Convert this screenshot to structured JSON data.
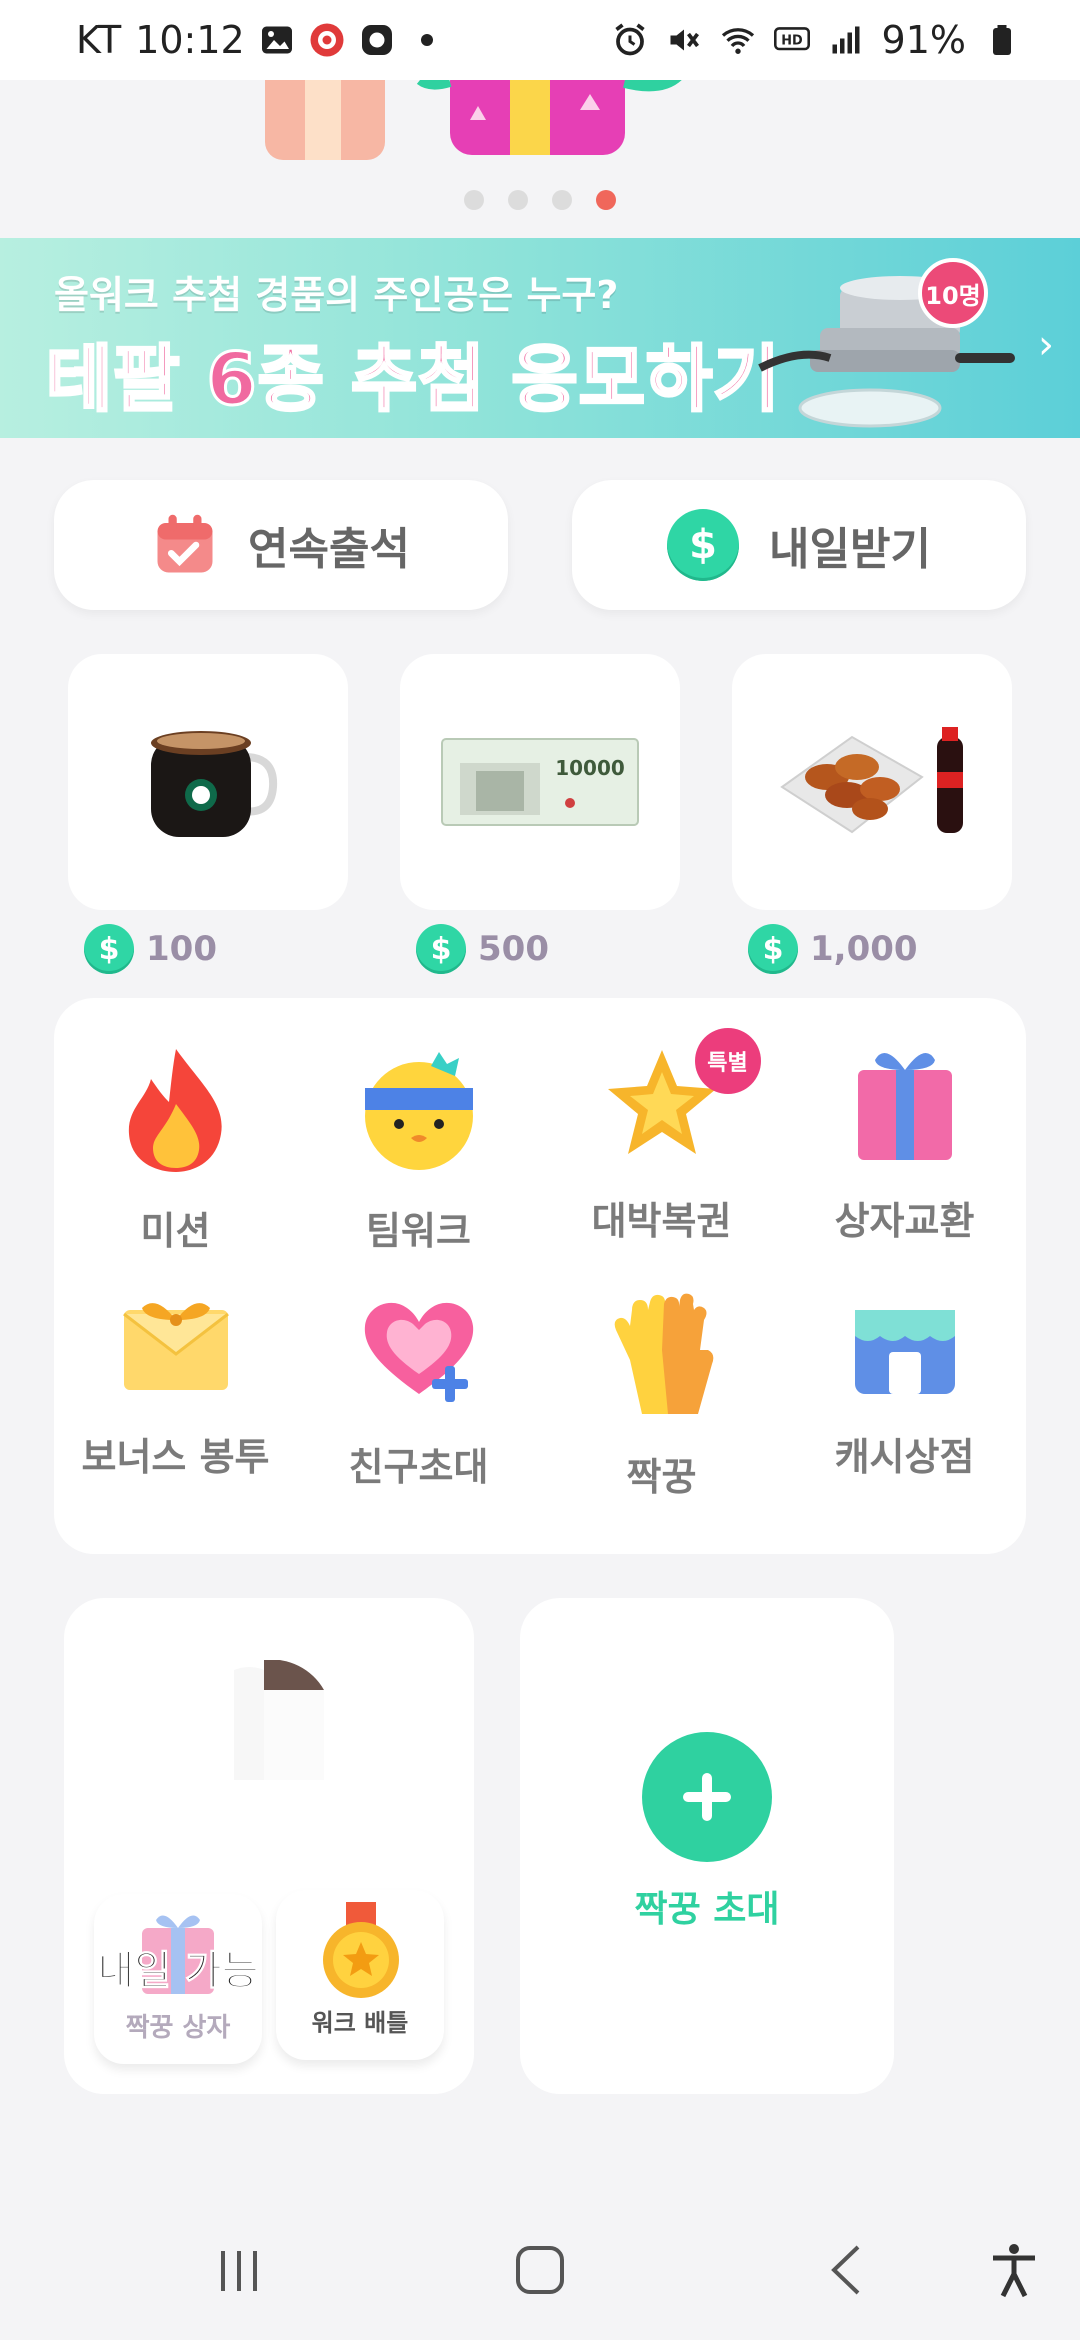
{
  "status": {
    "carrier": "KT",
    "time": "10:12",
    "battery": "91%",
    "icons": [
      "gallery-icon",
      "record-icon",
      "chat-icon",
      "dot-icon",
      "alarm-icon",
      "mute-icon",
      "wifi-icon",
      "hd-icon",
      "signal-icon",
      "battery-icon"
    ]
  },
  "carousel": {
    "page_count": 4,
    "active_index": 3
  },
  "banner": {
    "subtitle": "올워크 추첨 경품의 주인공은 누구?",
    "title": "테팔 6종 추첨 응모하기",
    "badge": "10명"
  },
  "attendance": {
    "streak_label": "연속출석",
    "tomorrow_label": "내일받기"
  },
  "rewards": [
    {
      "icon": "coffee-mug-icon",
      "price": "100"
    },
    {
      "icon": "gift-voucher-icon",
      "price": "500",
      "voucher_amount": "10000"
    },
    {
      "icon": "chicken-soda-icon",
      "price": "1,000"
    }
  ],
  "menu": [
    {
      "label": "미션",
      "icon": "fire-icon"
    },
    {
      "label": "팀워크",
      "icon": "face-headband-icon"
    },
    {
      "label": "대박복권",
      "icon": "star-icon",
      "badge": "특별"
    },
    {
      "label": "상자교환",
      "icon": "gift-box-icon"
    },
    {
      "label": "보너스 봉투",
      "icon": "envelope-icon"
    },
    {
      "label": "친구초대",
      "icon": "heart-plus-icon"
    },
    {
      "label": "짝꿍",
      "icon": "hands-icon"
    },
    {
      "label": "캐시상점",
      "icon": "store-icon"
    }
  ],
  "partner": {
    "box_overlay": "내일 가능",
    "box_label": "짝꿍 상자",
    "battle_label": "워크 배틀",
    "invite_label": "짝꿍 초대"
  },
  "colors": {
    "accent_green": "#2fd1a0",
    "accent_pink": "#f06aa0",
    "dot_active": "#f0675b"
  }
}
